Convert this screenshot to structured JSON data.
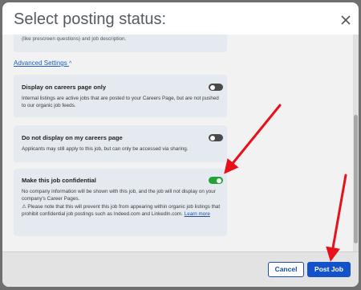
{
  "dialog": {
    "title": "Select posting status:"
  },
  "top_card": {
    "text": "(like prescreen questions) and job description."
  },
  "advanced_settings": {
    "label": "Advanced Settings",
    "chevron": "^"
  },
  "options": [
    {
      "title": "Display on careers page only",
      "description": "Internal listings are active jobs that are posted to your Careers Page, but are not pushed to our organic job feeds.",
      "toggle": "off"
    },
    {
      "title": "Do not display on my careers page",
      "description": "Applicants may still apply to this job, but can only be accessed via sharing.",
      "toggle": "off"
    },
    {
      "title": "Make this job confidential",
      "description": "No company information will be shown with this job, and the job will not display on your company's Career Pages.",
      "warning": "⚠ Please note that this will prevent this job from appearing within organic job listings that prohibit confidential job postings such as Indeed.com and LinkedIn.com.",
      "link": "Learn more",
      "toggle": "on"
    }
  ],
  "footer": {
    "cancel_label": "Cancel",
    "post_label": "Post Job"
  },
  "colors": {
    "primary": "#1352c9",
    "toggle_on": "#22a33a",
    "arrow": "#e8101a"
  }
}
